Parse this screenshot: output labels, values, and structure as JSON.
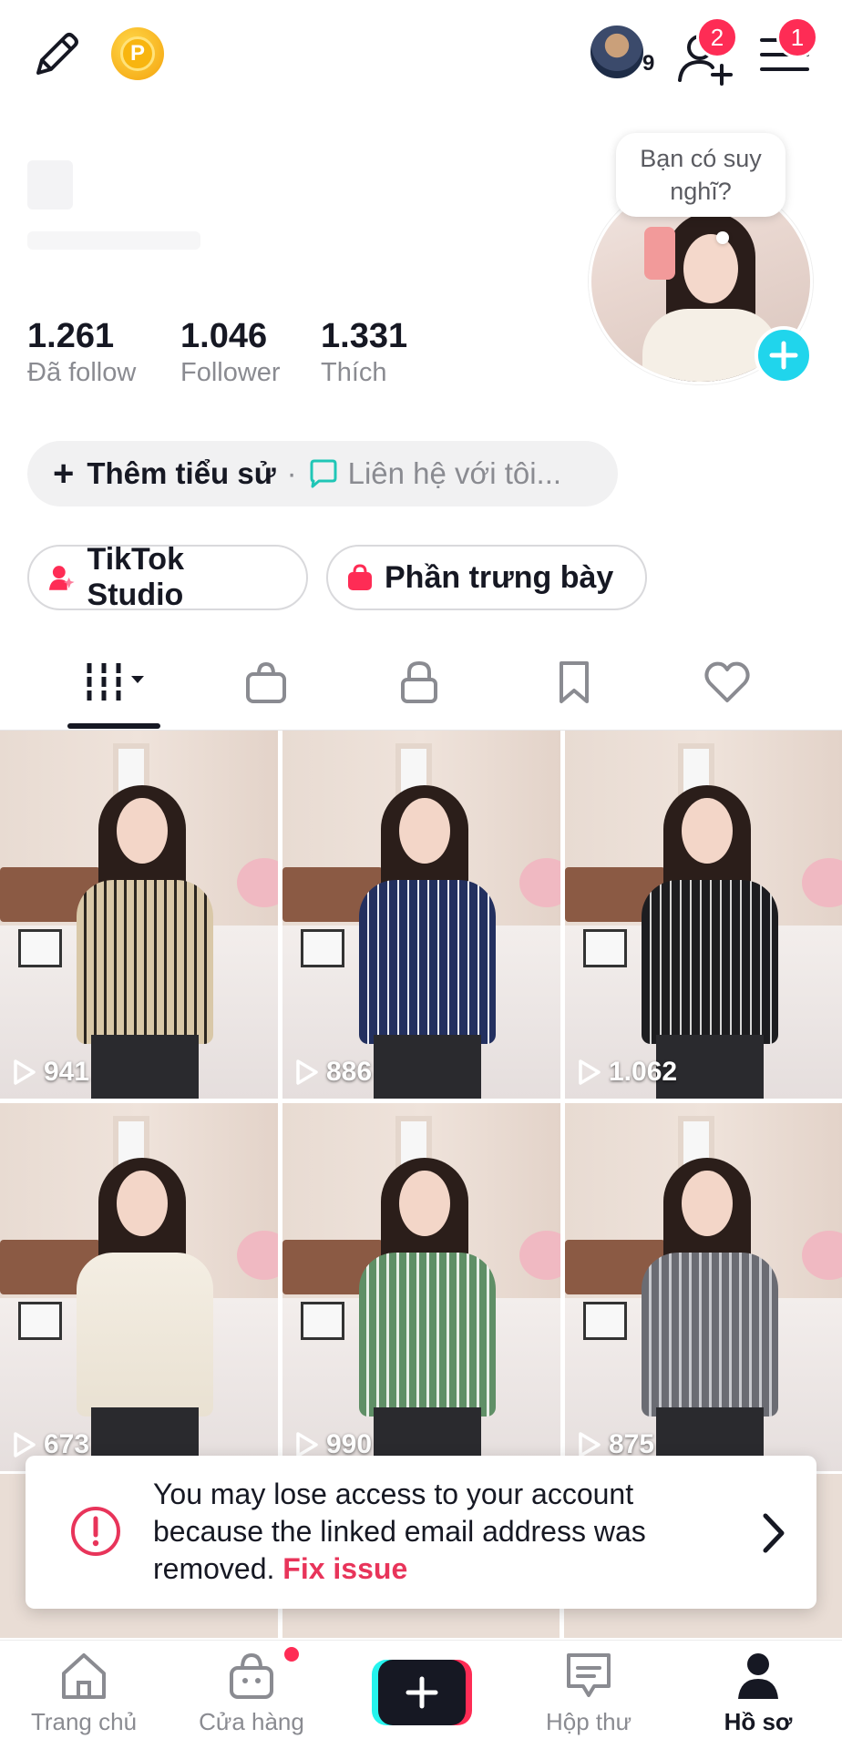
{
  "header": {
    "coin_letter": "P",
    "friend_count": "9",
    "add_friend_badge": "2",
    "menu_badge": "1"
  },
  "profile": {
    "thought_bubble": "Bạn có suy nghĩ?",
    "stats": [
      {
        "value": "1.261",
        "label": "Đã follow"
      },
      {
        "value": "1.046",
        "label": "Follower"
      },
      {
        "value": "1.331",
        "label": "Thích"
      }
    ],
    "bio_add": "Thêm tiểu sử",
    "bio_separator": "·",
    "contact": "Liên hệ với tôi..."
  },
  "buttons": {
    "studio": "TikTok Studio",
    "showcase": "Phần trưng bày"
  },
  "videos": [
    {
      "views": "941"
    },
    {
      "views": "886"
    },
    {
      "views": "1.062"
    },
    {
      "views": "673"
    },
    {
      "views": "990"
    },
    {
      "views": "875"
    }
  ],
  "banner": {
    "message": "You may lose access to your account because the linked email address was removed.",
    "action": "Fix issue"
  },
  "nav": {
    "home": "Trang chủ",
    "shop": "Cửa hàng",
    "inbox": "Hộp thư",
    "profile": "Hồ sơ"
  },
  "colors": {
    "accent": "#fe2c55",
    "cyan": "#20d5ec",
    "fix_link": "#e8345a"
  }
}
